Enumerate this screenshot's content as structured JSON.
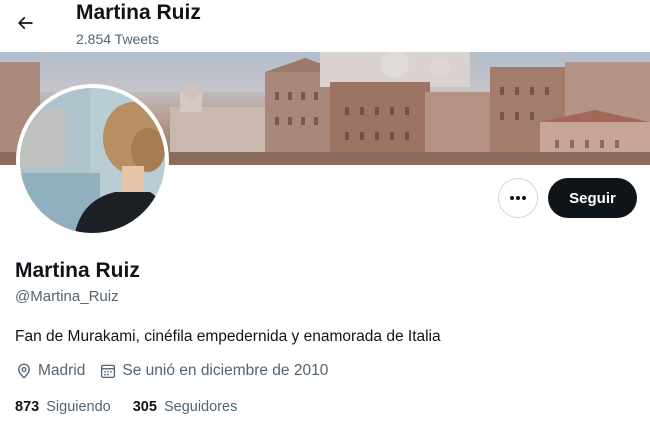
{
  "header": {
    "name": "Martina Ruiz",
    "tweet_count": "2.854 Tweets"
  },
  "profile": {
    "display_name": "Martina Ruiz",
    "handle": "@Martina_Ruiz",
    "bio": "Fan de Murakami, cinéfila empedernida y enamorada de Italia",
    "location": "Madrid",
    "joined": "Se unió en diciembre de 2010"
  },
  "actions": {
    "follow_label": "Seguir"
  },
  "stats": {
    "following_count": "873",
    "following_label": "Siguiendo",
    "followers_count": "305",
    "followers_label": "Seguidores"
  },
  "icons": {
    "back": "arrow-left-icon",
    "more": "more-dots-icon",
    "location": "location-pin-icon",
    "calendar": "calendar-icon"
  },
  "colors": {
    "text_primary": "#0f1419",
    "text_secondary": "#536471",
    "button_dark": "#0f1419"
  }
}
